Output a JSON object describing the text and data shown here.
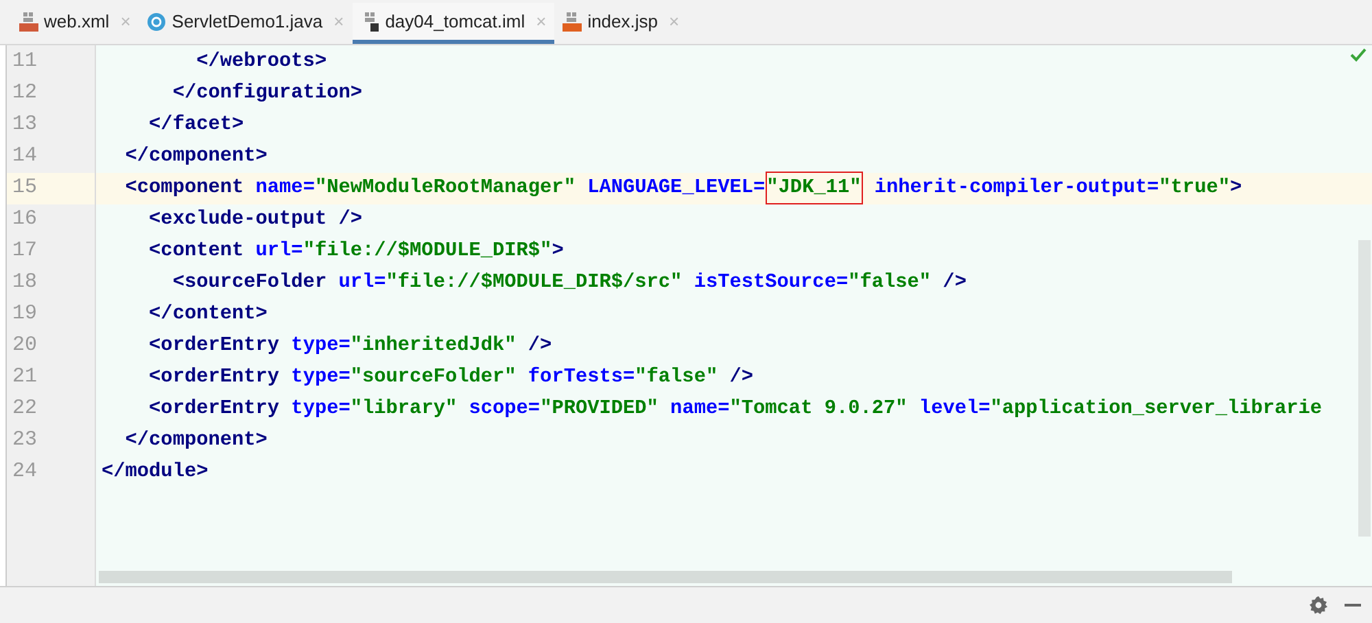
{
  "tabs": [
    {
      "label": "web.xml",
      "kind": "xml",
      "close": "×",
      "selected": false
    },
    {
      "label": "ServletDemo1.java",
      "kind": "java",
      "close": "×",
      "selected": false
    },
    {
      "label": "day04_tomcat.iml",
      "kind": "iml",
      "close": "×",
      "selected": true
    },
    {
      "label": "index.jsp",
      "kind": "jsp",
      "close": "×",
      "selected": false
    }
  ],
  "editor": {
    "lines": [
      {
        "number": "11",
        "current": false,
        "tokens": [
          {
            "kind": "tag",
            "t": "        </webroots>"
          }
        ]
      },
      {
        "number": "12",
        "current": false,
        "tokens": [
          {
            "kind": "tag",
            "t": "      </configuration>"
          }
        ]
      },
      {
        "number": "13",
        "current": false,
        "tokens": [
          {
            "kind": "tag",
            "t": "    </facet>"
          }
        ]
      },
      {
        "number": "14",
        "current": false,
        "tokens": [
          {
            "kind": "tag",
            "t": "  </component>"
          }
        ]
      },
      {
        "number": "15",
        "current": true,
        "tokens": [
          {
            "kind": "tag",
            "t": "  <component"
          },
          {
            "kind": "attr",
            "t": " name="
          },
          {
            "kind": "val",
            "t": "\"NewModuleRootManager\""
          },
          {
            "kind": "attr",
            "t": " LANGUAGE_LEVEL="
          },
          {
            "kind": "val",
            "t": "\"JDK_11\"",
            "boxed": true
          },
          {
            "kind": "attr",
            "t": " inherit-compiler-output="
          },
          {
            "kind": "val",
            "t": "\"true\""
          },
          {
            "kind": "tag",
            "t": ">"
          }
        ]
      },
      {
        "number": "16",
        "current": false,
        "tokens": [
          {
            "kind": "tag",
            "t": "    <exclude-output />"
          }
        ]
      },
      {
        "number": "17",
        "current": false,
        "tokens": [
          {
            "kind": "tag",
            "t": "    <content"
          },
          {
            "kind": "attr",
            "t": " url="
          },
          {
            "kind": "val",
            "t": "\"file://$MODULE_DIR$\""
          },
          {
            "kind": "tag",
            "t": ">"
          }
        ]
      },
      {
        "number": "18",
        "current": false,
        "tokens": [
          {
            "kind": "tag",
            "t": "      <sourceFolder"
          },
          {
            "kind": "attr",
            "t": " url="
          },
          {
            "kind": "val",
            "t": "\"file://$MODULE_DIR$/src\""
          },
          {
            "kind": "attr",
            "t": " isTestSource="
          },
          {
            "kind": "val",
            "t": "\"false\""
          },
          {
            "kind": "tag",
            "t": " />"
          }
        ]
      },
      {
        "number": "19",
        "current": false,
        "tokens": [
          {
            "kind": "tag",
            "t": "    </content>"
          }
        ]
      },
      {
        "number": "20",
        "current": false,
        "tokens": [
          {
            "kind": "tag",
            "t": "    <orderEntry"
          },
          {
            "kind": "attr",
            "t": " type="
          },
          {
            "kind": "val",
            "t": "\"inheritedJdk\""
          },
          {
            "kind": "tag",
            "t": " />"
          }
        ]
      },
      {
        "number": "21",
        "current": false,
        "tokens": [
          {
            "kind": "tag",
            "t": "    <orderEntry"
          },
          {
            "kind": "attr",
            "t": " type="
          },
          {
            "kind": "val",
            "t": "\"sourceFolder\""
          },
          {
            "kind": "attr",
            "t": " forTests="
          },
          {
            "kind": "val",
            "t": "\"false\""
          },
          {
            "kind": "tag",
            "t": " />"
          }
        ]
      },
      {
        "number": "22",
        "current": false,
        "tokens": [
          {
            "kind": "tag",
            "t": "    <orderEntry"
          },
          {
            "kind": "attr",
            "t": " type="
          },
          {
            "kind": "val",
            "t": "\"library\""
          },
          {
            "kind": "attr",
            "t": " scope="
          },
          {
            "kind": "val",
            "t": "\"PROVIDED\""
          },
          {
            "kind": "attr",
            "t": " name="
          },
          {
            "kind": "val",
            "t": "\"Tomcat 9.0.27\""
          },
          {
            "kind": "attr",
            "t": " level="
          },
          {
            "kind": "val",
            "t": "\"application_server_librarie"
          }
        ]
      },
      {
        "number": "23",
        "current": false,
        "tokens": [
          {
            "kind": "tag",
            "t": "  </component>"
          }
        ]
      },
      {
        "number": "24",
        "current": false,
        "tokens": [
          {
            "kind": "tag",
            "t": "</module>"
          }
        ]
      }
    ]
  }
}
